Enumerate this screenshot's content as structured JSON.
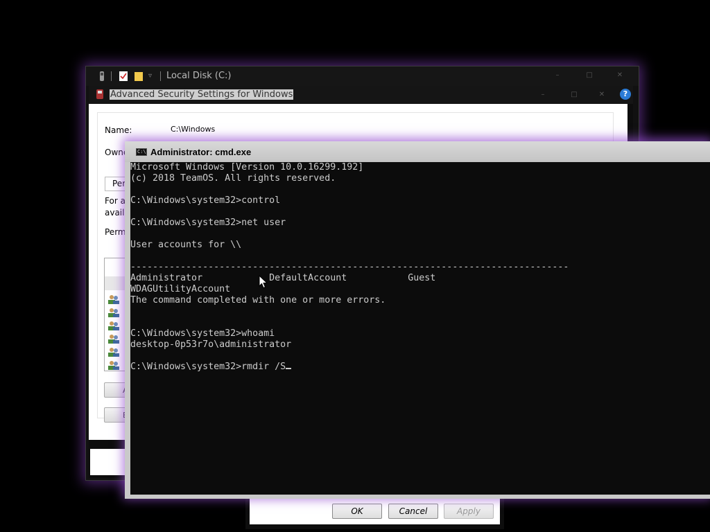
{
  "explorer": {
    "title": "Local Disk (C:)"
  },
  "advanced_security": {
    "title": "Advanced Security Settings for Windows",
    "name_label": "Name:",
    "name_value": "C:\\Windows",
    "owner_label": "Owne",
    "tab_label": "Per",
    "desc_line1": "For a",
    "desc_line2": "avail",
    "perm_entries_label": "Perm",
    "help_icon_glyph": "?",
    "add_button_stub": "A",
    "edit_button_stub": "E"
  },
  "dialog_buttons": {
    "ok": "OK",
    "cancel": "Cancel",
    "apply": "Apply"
  },
  "cmd": {
    "title": "Administrator: cmd.exe",
    "icon_glyph": "C:\\",
    "lines": [
      "Microsoft Windows [Version 10.0.16299.192]",
      "(c) 2018 TeamOS. All rights reserved.",
      "",
      "C:\\Windows\\system32>control",
      "",
      "C:\\Windows\\system32>net user",
      "",
      "User accounts for \\\\",
      "",
      "-------------------------------------------------------------------------------",
      "Administrator            DefaultAccount           Guest",
      "WDAGUtilityAccount",
      "The command completed with one or more errors.",
      "",
      "",
      "C:\\Windows\\system32>whoami",
      "desktop-0p53r7o\\administrator",
      "",
      "C:\\Windows\\system32>rmdir /S"
    ]
  },
  "colors": {
    "accent_glow": "#8c46c8",
    "console_bg": "#0c0c0c",
    "console_fg": "#cccccc"
  }
}
